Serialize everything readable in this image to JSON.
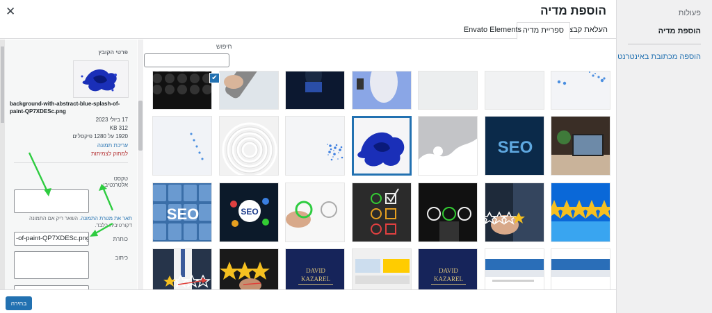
{
  "header": {
    "title": "הוספת מדיה",
    "close_icon": "close-icon"
  },
  "tabs": [
    {
      "label": "העלאת קבצים"
    },
    {
      "label": "ספריית מדיה",
      "active": true
    },
    {
      "label": "Envato Elements"
    }
  ],
  "menu": {
    "title": "פעולות",
    "items": [
      {
        "label": "הוספת מדיה"
      }
    ],
    "link": "הוספה מכתובת באינטרנט"
  },
  "search": {
    "label": "חיפוש",
    "value": ""
  },
  "attachment_details": {
    "heading": "פרטי הקובץ",
    "filename": "background-with-abstract-blue-splash-of-paint-QP7XDESc.png",
    "date": "17 ביולי 2023",
    "filesize": "312 KB",
    "dimensions": "1920 על 1280 פיקסלים",
    "edit_link": "עריכת תמונה",
    "delete_link": "למחוק לצמיתות",
    "alt_label": "טקסט אלטרנטיבי",
    "alt_value": "",
    "alt_help_link": "תאר את מטרת התמונה.",
    "alt_help_text": "השאר ריק אם התמונה דקורטיבית בלבד.",
    "title_label": "כותרת",
    "title_value": "-of-paint-QP7XDESc.png",
    "caption_label": "כיתוב",
    "caption_value": ""
  },
  "grid": {
    "selected_index": 10,
    "thumbnails": [
      {
        "name": "blue-dots-white"
      },
      {
        "name": "light-grey-texture"
      },
      {
        "name": "light-grey-texture-2"
      },
      {
        "name": "woman-blue-shirt"
      },
      {
        "name": "person-dark-blue"
      },
      {
        "name": "hand-remote"
      },
      {
        "name": "black-sphere-balls"
      },
      {
        "name": "laptop-desk"
      },
      {
        "name": "seo-blue-tech"
      },
      {
        "name": "image-placeholder"
      },
      {
        "name": "blue-paint-splash"
      },
      {
        "name": "blue-spray-white"
      },
      {
        "name": "fingerprint-white"
      },
      {
        "name": "blue-dots-light"
      },
      {
        "name": "five-stars-blue"
      },
      {
        "name": "hand-stars-suit"
      },
      {
        "name": "emoji-faces-dark"
      },
      {
        "name": "emoji-checklist-chalk"
      },
      {
        "name": "hand-smiley"
      },
      {
        "name": "seo-icons-hand"
      },
      {
        "name": "seo-keyboard"
      },
      {
        "name": "website-screenshot"
      },
      {
        "name": "website-screenshot-2"
      },
      {
        "name": "david-kazarel-card"
      },
      {
        "name": "website-collage"
      },
      {
        "name": "david-kazarel-card-2"
      },
      {
        "name": "stars-hand-dark"
      },
      {
        "name": "rating-stars-suit"
      }
    ],
    "card_text": [
      "DAVID",
      "KAZAREL"
    ]
  },
  "toolbar": {
    "select_label": "בחירה"
  },
  "colors": {
    "accent": "#2271b1",
    "annotation_arrow": "#2ecc40",
    "annotation_red": "#e0403a"
  }
}
